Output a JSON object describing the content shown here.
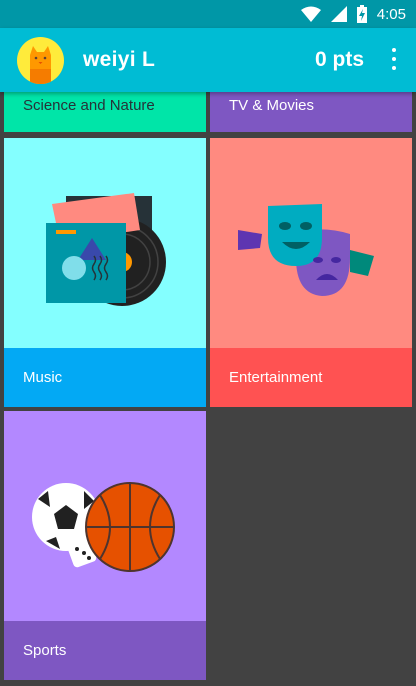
{
  "status_bar": {
    "time": "4:05",
    "icons": [
      "wifi-icon",
      "cellular-signal-icon",
      "battery-charging-icon"
    ]
  },
  "app_bar": {
    "user_name": "weiyi L",
    "points": "0 pts",
    "avatar_icon": "cat-avatar-icon",
    "menu_icon": "more-vert-icon"
  },
  "categories": [
    {
      "label": "Science and Nature",
      "bg": "#00e5a8",
      "label_bg": "#00e5a8",
      "label_color": "#263238"
    },
    {
      "label": "TV & Movies",
      "bg": "#7e57c2",
      "label_bg": "#7e57c2",
      "label_color": "#ffffff"
    },
    {
      "label": "Music",
      "bg": "#84ffff",
      "label_bg": "#03a9f4",
      "label_color": "#ffffff",
      "icon": "vinyl-record-icon"
    },
    {
      "label": "Entertainment",
      "bg": "#ff8a80",
      "label_bg": "#ff5252",
      "label_color": "#ffffff",
      "icon": "theater-masks-icon"
    },
    {
      "label": "Sports",
      "bg": "#b388ff",
      "label_bg": "#7e57c2",
      "label_color": "#ffffff",
      "icon": "sports-balls-icon"
    }
  ]
}
